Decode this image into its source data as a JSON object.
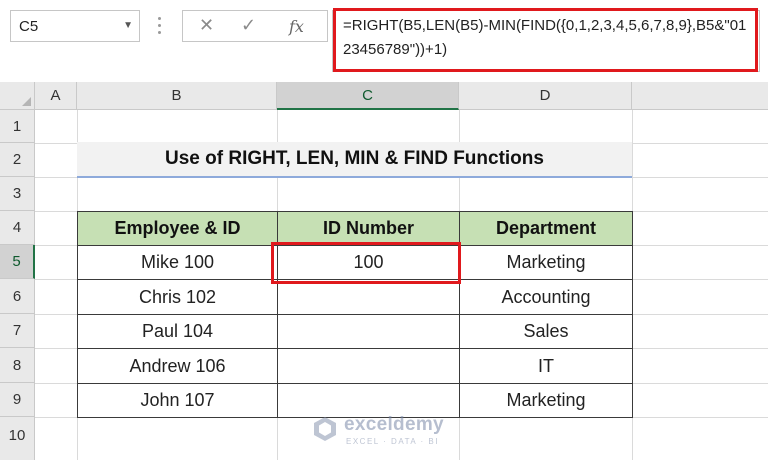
{
  "formula_bar": {
    "name_box": "C5",
    "cancel_icon": "✕",
    "enter_icon": "✓",
    "fx_label": "fx",
    "formula": "=RIGHT(B5,LEN(B5)-MIN(FIND({0,1,2,3,4,5,6,7,8,9},B5&\"0123456789\"))+1)"
  },
  "columns": [
    "A",
    "B",
    "C",
    "D"
  ],
  "rows": [
    "1",
    "2",
    "3",
    "4",
    "5",
    "6",
    "7",
    "8",
    "9",
    "10"
  ],
  "selected_cell": "C5",
  "title": "Use of RIGHT, LEN, MIN & FIND Functions",
  "table": {
    "headers": [
      "Employee & ID",
      "ID Number",
      "Department"
    ],
    "rows": [
      [
        "Mike 100",
        "100",
        "Marketing"
      ],
      [
        "Chris 102",
        "",
        "Accounting"
      ],
      [
        "Paul 104",
        "",
        "Sales"
      ],
      [
        "Andrew 106",
        "",
        "IT"
      ],
      [
        "John 107",
        "",
        "Marketing"
      ]
    ]
  },
  "watermark": {
    "name": "exceldemy",
    "tagline": "EXCEL · DATA · BI"
  },
  "colors": {
    "header_fill": "#c6e0b4",
    "highlight": "#e0191d",
    "title_underline": "#8eaadb",
    "excel_green": "#217346"
  }
}
